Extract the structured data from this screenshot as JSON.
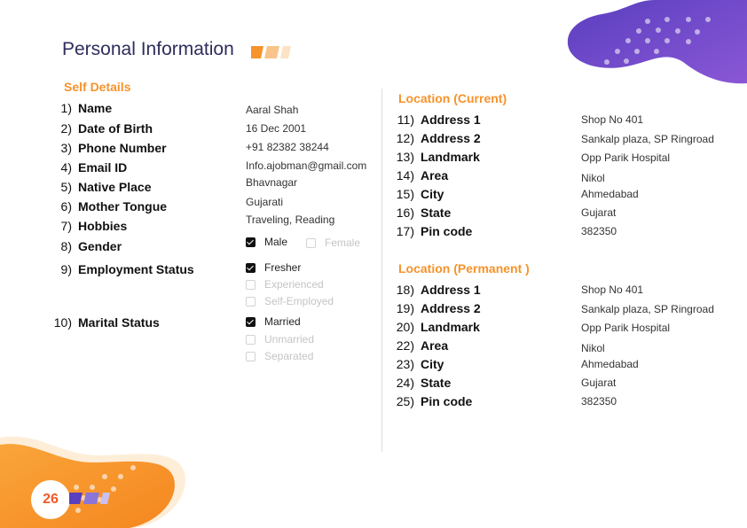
{
  "title": "Personal Information",
  "page_number": "26",
  "colors": {
    "title": "#2e2d5c",
    "section": "#f6932b",
    "accent_orange": "#f6932b",
    "accent_purple": "#6a4fc8",
    "page_number": "#f05a28"
  },
  "self_details": {
    "heading": "Self Details",
    "rows": [
      {
        "num": "1)",
        "label": "Name",
        "value": "Aaral Shah"
      },
      {
        "num": "2)",
        "label": "Date of Birth",
        "value": "16 Dec 2001"
      },
      {
        "num": "3)",
        "label": "Phone Number",
        "value": "+91 82382 38244"
      },
      {
        "num": "4)",
        "label": "Email ID",
        "value": "Info.ajobman@gmail.com"
      },
      {
        "num": "5)",
        "label": "Native Place",
        "value": "Bhavnagar"
      },
      {
        "num": "6)",
        "label": "Mother Tongue",
        "value": "Gujarati"
      },
      {
        "num": "7)",
        "label": "Hobbies",
        "value": "Traveling, Reading"
      },
      {
        "num": "8)",
        "label": "Gender"
      },
      {
        "num": "9)",
        "label": "Employment  Status"
      },
      {
        "num": "10)",
        "label": "Marital Status"
      }
    ],
    "gender_options": [
      {
        "label": "Male",
        "checked": true
      },
      {
        "label": "Female",
        "checked": false
      }
    ],
    "employment_options": [
      {
        "label": "Fresher",
        "checked": true
      },
      {
        "label": "Experienced",
        "checked": false
      },
      {
        "label": "Self-Employed",
        "checked": false
      }
    ],
    "marital_options": [
      {
        "label": "Married",
        "checked": true
      },
      {
        "label": "Unmarried",
        "checked": false
      },
      {
        "label": "Separated",
        "checked": false
      }
    ]
  },
  "location_current": {
    "heading": "Location (Current)",
    "rows": [
      {
        "num": "11)",
        "label": "Address  1",
        "value": "Shop No 401"
      },
      {
        "num": "12)",
        "label": "Address 2",
        "value": "Sankalp plaza, SP Ringroad"
      },
      {
        "num": "13)",
        "label": "Landmark",
        "value": "Opp Parik Hospital"
      },
      {
        "num": "14)",
        "label": "Area",
        "value": "Nikol"
      },
      {
        "num": "15)",
        "label": "City",
        "value": "Ahmedabad"
      },
      {
        "num": "16)",
        "label": "State",
        "value": "Gujarat"
      },
      {
        "num": "17)",
        "label": "Pin code",
        "value": "382350"
      }
    ]
  },
  "location_permanent": {
    "heading": "Location (Permanent )",
    "rows": [
      {
        "num": "18)",
        "label": "Address  1",
        "value": "Shop No 401"
      },
      {
        "num": "19)",
        "label": "Address 2",
        "value": "Sankalp plaza, SP Ringroad"
      },
      {
        "num": "20)",
        "label": "Landmark",
        "value": "Opp Parik Hospital"
      },
      {
        "num": "22)",
        "label": "Area",
        "value": "Nikol"
      },
      {
        "num": "23)",
        "label": "City",
        "value": "Ahmedabad"
      },
      {
        "num": "24)",
        "label": "State",
        "value": "Gujarat"
      },
      {
        "num": "25)",
        "label": "Pin code",
        "value": "382350"
      }
    ]
  }
}
